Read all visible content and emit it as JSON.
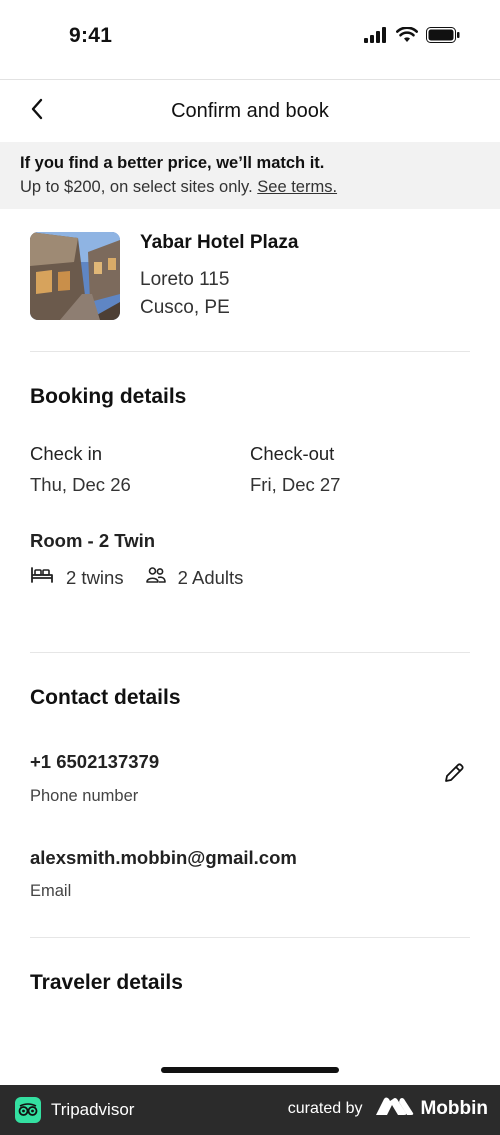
{
  "status_bar": {
    "time": "9:41"
  },
  "nav": {
    "title": "Confirm and book"
  },
  "banner": {
    "headline": "If you find a better price, we’ll match it.",
    "detail": "Up to $200, on select sites only.",
    "terms_link": "See terms."
  },
  "hotel": {
    "name": "Yabar Hotel Plaza",
    "address_line1": "Loreto 115",
    "address_line2": "Cusco, PE"
  },
  "booking": {
    "title": "Booking details",
    "check_in_label": "Check in",
    "check_in_value": "Thu, Dec 26",
    "check_out_label": "Check-out",
    "check_out_value": "Fri, Dec 27",
    "room": "Room - 2 Twin",
    "beds": "2 twins",
    "guests": "2 Adults"
  },
  "contact": {
    "title": "Contact details",
    "phone": "+1 6502137379",
    "phone_label": "Phone number",
    "email": "alexsmith.mobbin@gmail.com",
    "email_label": "Email"
  },
  "traveler": {
    "title": "Traveler details"
  },
  "footer": {
    "brand": "Tripadvisor",
    "curated_by": "curated by",
    "curator": "Mobbin"
  },
  "icons": {
    "back": "chevron-left-icon",
    "bed": "bed-icon",
    "guests": "people-icon",
    "edit": "pencil-icon"
  },
  "colors": {
    "banner_bg": "#f2f2f2",
    "footer_bg": "#2b2b2b",
    "tripadvisor_green": "#34e0a1"
  }
}
